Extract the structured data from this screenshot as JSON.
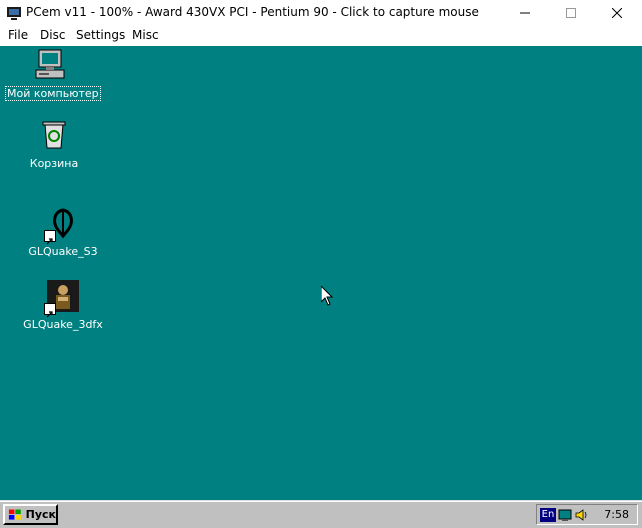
{
  "window": {
    "title": "PCem v11 - 100% - Award 430VX PCI - Pentium 90 - Click to capture mouse"
  },
  "menu": [
    "File",
    "Disc",
    "Settings",
    "Misc"
  ],
  "desktop": {
    "background": "#008080",
    "icons": [
      {
        "label": "Мой компьютер",
        "icon": "my-computer-icon",
        "selected": true
      },
      {
        "label": "Корзина",
        "icon": "recycle-bin-icon"
      },
      {
        "label": "GLQuake_S3",
        "icon": "quake-icon",
        "shortcut": true
      },
      {
        "label": "GLQuake_3dfx",
        "icon": "quake-3dfx-icon",
        "shortcut": true
      }
    ]
  },
  "taskbar": {
    "start_label": "Пуск",
    "language": "En",
    "clock": "7:58"
  }
}
